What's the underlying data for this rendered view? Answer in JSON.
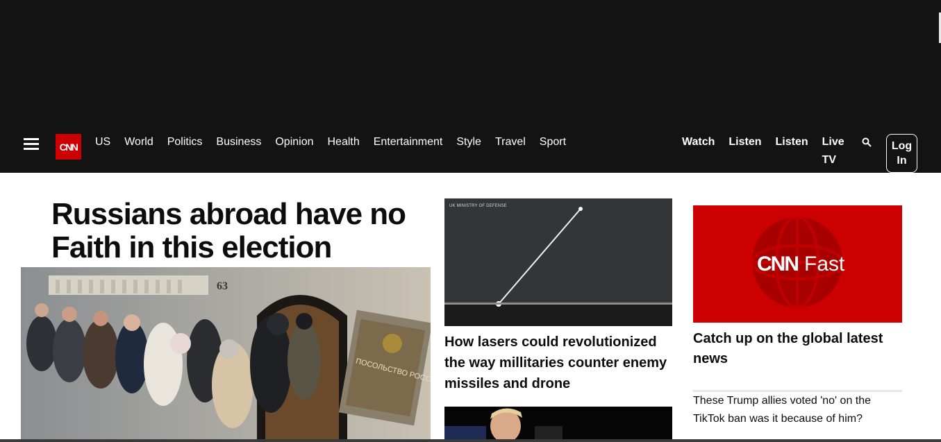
{
  "nav": {
    "menu_icon": "hamburger-icon",
    "logo_text": "CNN",
    "links": [
      "US",
      "World",
      "Politics",
      "Business",
      "Opinion",
      "Health",
      "Entertainment",
      "Style",
      "Travel",
      "Sport"
    ],
    "right_links": [
      "Watch",
      "Listen",
      "Listen"
    ],
    "live_tv": "Live TV",
    "search_icon": "search-icon",
    "login": "Log In"
  },
  "lead": {
    "headline": "Russians abroad have no Faith in this election",
    "sign_text": "ПОСОЛЬСТВО РОССИЙСКОЙ ФЕДЕРАЦИИ",
    "house_number": "63"
  },
  "middle": {
    "image_credit": "UK MINISTRY OF DEFENSE",
    "story_title": "How lasers could revolutionized the way millitaries counter enemy missiles and drone"
  },
  "right": {
    "logo_cnn": "CNN",
    "logo_fast": "Fast",
    "title": "Catch up on the global latest news",
    "story_text": "These Trump allies voted 'no' on the TikTok ban was it because of him?"
  },
  "colors": {
    "brand_red": "#cc0000",
    "nav_bg": "#131313"
  }
}
